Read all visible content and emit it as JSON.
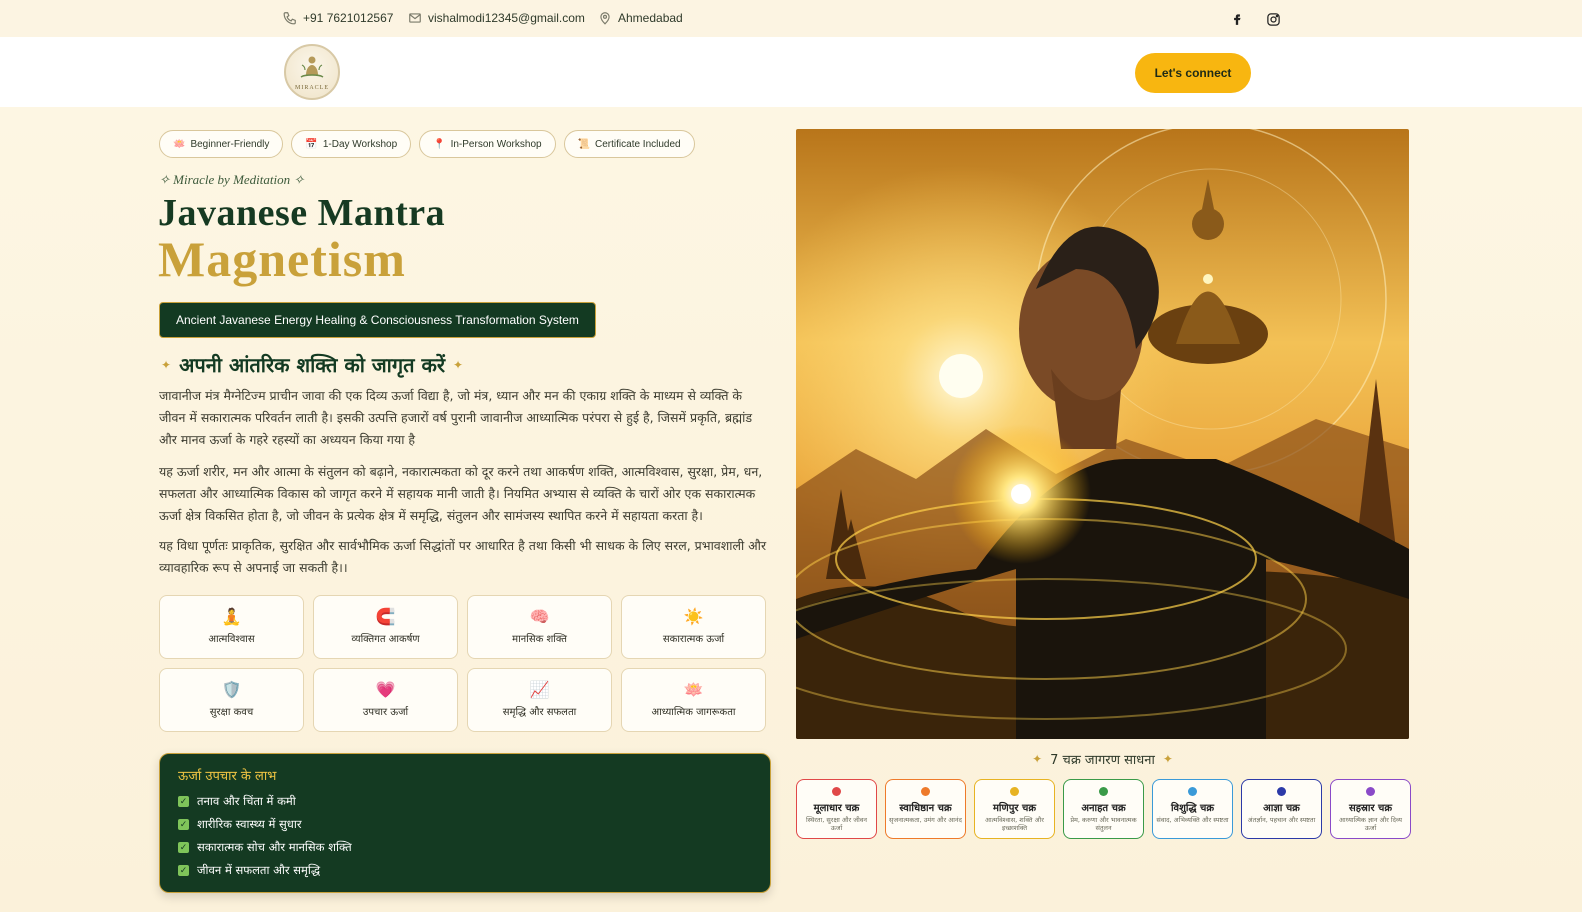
{
  "topbar": {
    "phone": "+91 7621012567",
    "email": "vishalmodi12345@gmail.com",
    "location": "Ahmedabad",
    "social": [
      "facebook-icon",
      "instagram-icon"
    ]
  },
  "header": {
    "logo_text": "MIRACLE",
    "cta_label": "Let's connect"
  },
  "tags": [
    {
      "icon": "🪷",
      "label": "Beginner-Friendly"
    },
    {
      "icon": "📅",
      "label": "1-Day Workshop"
    },
    {
      "icon": "📍",
      "label": "In-Person Workshop"
    },
    {
      "icon": "📜",
      "label": "Certificate Included"
    }
  ],
  "hero_text": {
    "eyebrow": "✧ Miracle by Meditation ✧",
    "title_line1": "Javanese Mantra",
    "title_line2": "Magnetism",
    "subtitle": "Ancient Javanese Energy Healing & Consciousness Transformation System",
    "hindi_heading": "अपनी आंतरिक शक्ति को जागृत करें",
    "paragraphs": [
      "जावानीज मंत्र मैग्नेटिज्म प्राचीन जावा की एक दिव्य ऊर्जा विद्या है, जो मंत्र, ध्यान और मन की एकाग्र शक्ति के माध्यम से व्यक्ति के जीवन में सकारात्मक परिवर्तन लाती है। इसकी उत्पत्ति हजारों वर्ष पुरानी जावानीज आध्यात्मिक परंपरा से हुई है, जिसमें प्रकृति, ब्रह्मांड और मानव ऊर्जा के गहरे रहस्यों का अध्ययन किया गया है",
      "यह ऊर्जा शरीर, मन और आत्मा के संतुलन को बढ़ाने, नकारात्मकता को दूर करने तथा आकर्षण शक्ति, आत्मविश्वास, सुरक्षा, प्रेम, धन, सफलता और आध्यात्मिक विकास को जागृत करने में सहायक मानी जाती है। नियमित अभ्यास से व्यक्ति के चारों ओर एक सकारात्मक ऊर्जा क्षेत्र विकसित होता है, जो जीवन के प्रत्येक क्षेत्र में समृद्धि, संतुलन और सामंजस्य स्थापित करने में सहायता करता है।",
      "यह विधा पूर्णतः प्राकृतिक, सुरक्षित और सार्वभौमिक ऊर्जा सिद्धांतों पर आधारित है तथा किसी भी साधक के लिए सरल, प्रभावशाली और व्यावहारिक रूप से अपनाई जा सकती है।।"
    ]
  },
  "features": [
    {
      "icon": "🧘",
      "label": "आत्मविश्वास"
    },
    {
      "icon": "🧲",
      "label": "व्यक्तिगत आकर्षण"
    },
    {
      "icon": "🧠",
      "label": "मानसिक शक्ति"
    },
    {
      "icon": "☀️",
      "label": "सकारात्मक ऊर्जा"
    },
    {
      "icon": "🛡️",
      "label": "सुरक्षा कवच"
    },
    {
      "icon": "💗",
      "label": "उपचार ऊर्जा"
    },
    {
      "icon": "📈",
      "label": "समृद्धि और सफलता"
    },
    {
      "icon": "🪷",
      "label": "आध्यात्मिक जागरूकता"
    }
  ],
  "benefits": {
    "title": "ऊर्जा उपचार के लाभ",
    "items": [
      "तनाव और चिंता में कमी",
      "शारीरिक स्वास्थ्य में सुधार",
      "सकारात्मक सोच और मानसिक शक्ति",
      "जीवन में सफलता और समृद्धि"
    ]
  },
  "chakra_section": {
    "heading": "7 चक्र जागरण साधना",
    "chakras": [
      {
        "name": "मूलाधार चक्र",
        "desc": "स्थिरता, सुरक्षा और जीवन ऊर्जा",
        "color": "#e04848"
      },
      {
        "name": "स्वाधिष्ठान चक्र",
        "desc": "सृजनात्मकता, उमंग और आनंद",
        "color": "#ee7a2a"
      },
      {
        "name": "मणिपुर चक्र",
        "desc": "आत्मविश्वास, शक्ति और इच्छाशक्ति",
        "color": "#e7b322"
      },
      {
        "name": "अनाहत चक्र",
        "desc": "प्रेम, करुणा और भावनात्मक संतुलन",
        "color": "#3a9a48"
      },
      {
        "name": "विशुद्धि चक्र",
        "desc": "संवाद, अभिव्यक्ति और स्पष्टता",
        "color": "#3a9ad8"
      },
      {
        "name": "आज्ञा चक्र",
        "desc": "अंतर्ज्ञान, पहचान और स्पष्टता",
        "color": "#2c3aa8"
      },
      {
        "name": "सहस्रार चक्र",
        "desc": "आध्यात्मिक ज्ञान और दिव्य ऊर्जा",
        "color": "#8a4ac8"
      }
    ]
  },
  "colors": {
    "brand_green": "#143a22",
    "brand_gold": "#c9a13a",
    "cta_yellow": "#f8b610"
  }
}
